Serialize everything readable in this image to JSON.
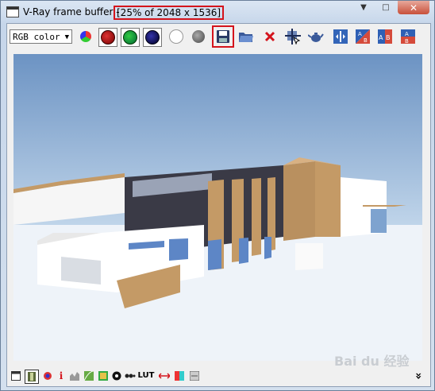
{
  "window": {
    "title": "V-Ray frame buffer -",
    "title_info": "[25% of 2048 x 1536]",
    "controls": {
      "minimize": "▼",
      "maximize": "□",
      "close": "✕"
    }
  },
  "toolbar": {
    "channel_select": "RGB color",
    "buttons": [
      {
        "name": "rgb-channels-button",
        "icon": "rgb-circle-icon"
      },
      {
        "name": "red-channel-button",
        "icon": "red-dot-icon",
        "color": "#a51010"
      },
      {
        "name": "green-channel-button",
        "icon": "green-dot-icon",
        "color": "#0f8a1c"
      },
      {
        "name": "blue-channel-button",
        "icon": "blue-dot-icon",
        "color": "#101080"
      },
      {
        "name": "alpha-channel-button",
        "icon": "white-dot-icon"
      },
      {
        "name": "mono-button",
        "icon": "grey-dot-icon"
      },
      {
        "name": "save-image-button",
        "icon": "floppy-disk-icon"
      },
      {
        "name": "load-image-button",
        "icon": "open-folder-icon"
      },
      {
        "name": "clear-image-button",
        "icon": "red-x-icon"
      },
      {
        "name": "duplicate-to-mtl-button",
        "icon": "cursor-crosshair-icon"
      },
      {
        "name": "render-last-button",
        "icon": "teapot-icon"
      },
      {
        "name": "ab-compare-button",
        "icon": "compare-icon"
      },
      {
        "name": "ab-horizontal-button",
        "icon": "ab-horizontal-icon"
      },
      {
        "name": "ab-a-button",
        "icon": "ab-icon"
      },
      {
        "name": "ab-b-button",
        "icon": "ab-vertical-icon"
      }
    ]
  },
  "statusbar": {
    "lut_label": "LUT",
    "info_label": "i",
    "expand": "»"
  },
  "watermark": "Bai du 经验",
  "colors": {
    "highlight": "#d4141c",
    "sky_top": "#6c93c3",
    "ground": "#eef3f9",
    "facade_brown": "#c49a66"
  }
}
